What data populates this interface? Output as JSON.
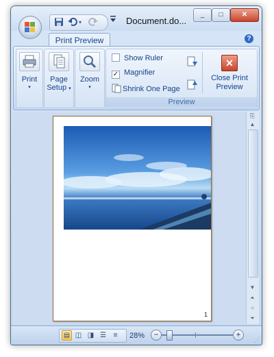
{
  "window": {
    "title": "Document.do...",
    "quick_access": {
      "save_icon": "save-icon",
      "undo_icon": "undo-icon",
      "redo_icon": "redo-icon",
      "customize_icon": "chevron-down-icon"
    },
    "controls": {
      "minimize": "_",
      "maximize": "□",
      "close": "✕"
    }
  },
  "ribbon": {
    "tab_label": "Print Preview",
    "help_glyph": "?",
    "print_group": {
      "print_label": "Print"
    },
    "page_setup_group": {
      "line1": "Page",
      "line2": "Setup"
    },
    "zoom_group": {
      "zoom_label": "Zoom"
    },
    "preview_group": {
      "label": "Preview",
      "show_ruler": {
        "label": "Show Ruler",
        "checked": false
      },
      "magnifier": {
        "label": "Magnifier",
        "checked": true
      },
      "shrink_one_page": {
        "label": "Shrink One Page"
      },
      "close_line1": "Close Print",
      "close_line2": "Preview"
    },
    "dropdown_arrow": "▾"
  },
  "preview": {
    "page_number": "1"
  },
  "scrollbar": {
    "up": "▲",
    "down": "▼",
    "prev_page": "⏶",
    "select_browse": "○",
    "next_page": "⏷"
  },
  "status": {
    "zoom_percent": "28%",
    "zoom_out": "−",
    "zoom_in": "+",
    "zoom_level_fraction": 0.28,
    "active_view": "print-layout"
  },
  "colors": {
    "frame": "#c4d8f0",
    "accent": "#15428b",
    "close_button": "#c8452c"
  }
}
